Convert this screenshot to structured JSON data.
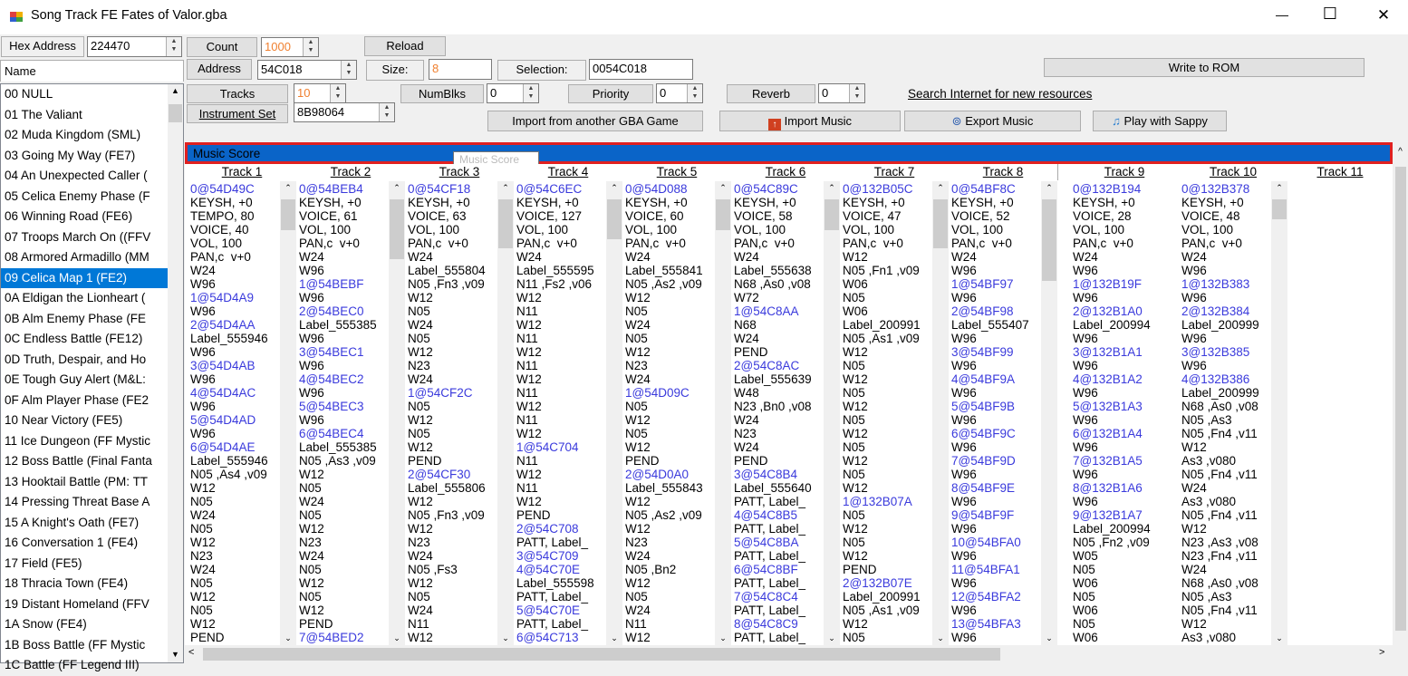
{
  "window": {
    "title": "Song Track FE Fates of Valor.gba",
    "minimize": "—",
    "maximize": "☐",
    "close": "✕"
  },
  "sidebar": {
    "hex_label": "Hex Address",
    "hex_value": "224470",
    "name_header": "Name",
    "songs": [
      "00 NULL",
      "01 The Valiant",
      "02 Muda Kingdom (SML)",
      "03 Going My Way (FE7)",
      "04 An Unexpected Caller (",
      "05 Celica Enemy Phase (F",
      "06 Winning Road (FE6)",
      "07 Troops March On ((FFV",
      "08 Armored Armadillo (MM",
      "09 Celica Map 1 (FE2)",
      "0A Eldigan the Lionheart (",
      "0B Alm Enemy Phase (FE",
      "0C Endless Battle (FE12)",
      "0D Truth, Despair, and Ho",
      "0E Tough Guy Alert (M&L:",
      "0F Alm Player Phase (FE2",
      "10 Near Victory (FE5)",
      "11 Ice Dungeon (FF Mystic",
      "12 Boss Battle (Final Fanta",
      "13 Hooktail Battle (PM: TT",
      "14 Pressing Threat Base A",
      "15 A Knight's Oath (FE7)",
      "16 Conversation 1 (FE4)",
      "17 Field (FE5)",
      "18 Thracia Town (FE4)",
      "19 Distant Homeland (FFV",
      "1A Snow (FE4)",
      "1B Boss Battle (FF Mystic",
      "1C Battle (FF Legend III)"
    ],
    "selected_index": 9
  },
  "toolbar": {
    "count_label": "Count",
    "count_value": "1000",
    "reload_label": "Reload",
    "address_label": "Address",
    "address_value": "54C018",
    "size_label": "Size:",
    "size_value": "8",
    "selection_label": "Selection:",
    "selection_value": "0054C018",
    "write_rom": "Write to ROM",
    "tracks_label": "Tracks",
    "tracks_value": "10",
    "numblks_label": "NumBlks",
    "numblks_value": "0",
    "priority_label": "Priority",
    "priority_value": "0",
    "reverb_label": "Reverb",
    "reverb_value": "0",
    "search_link": "Search Internet for new resources",
    "instrument_label": "Instrument Set",
    "instrument_value": "8B98064",
    "import_gba": "Import from another GBA Game",
    "import_music": "Import Music",
    "export_music": "Export Music",
    "play_sappy": "Play with Sappy"
  },
  "score": {
    "bar_label": "Music Score",
    "tooltip": "Music Score"
  },
  "tracks": [
    {
      "title": "Track 1",
      "lines": [
        "0@54D49C",
        "KEYSH, +0",
        "TEMPO, 80",
        "VOICE, 40",
        "VOL, 100",
        "PAN,c  v+0",
        "W24",
        "W96",
        "1@54D4A9",
        "W96",
        "2@54D4AA",
        "Label_555946",
        "W96",
        "3@54D4AB",
        "W96",
        "4@54D4AC",
        "W96",
        "5@54D4AD",
        "W96",
        "6@54D4AE",
        "Label_555946",
        "N05 ,As4 ,v09",
        "W12",
        "N05",
        "W24",
        "N05",
        "W12",
        "N23",
        "W24",
        "N05",
        "W12",
        "N05",
        "W12",
        "PEND"
      ]
    },
    {
      "title": "Track 2",
      "lines": [
        "0@54BEB4",
        "KEYSH, +0",
        "VOICE, 61",
        "VOL, 100",
        "PAN,c  v+0",
        "W24",
        "W96",
        "1@54BEBF",
        "W96",
        "2@54BEC0",
        "Label_555385",
        "W96",
        "3@54BEC1",
        "W96",
        "4@54BEC2",
        "W96",
        "5@54BEC3",
        "W96",
        "6@54BEC4",
        "Label_555385",
        "N05 ,As3 ,v09",
        "W12",
        "N05",
        "W24",
        "N05",
        "W12",
        "N23",
        "W24",
        "N05",
        "W12",
        "N05",
        "W12",
        "PEND",
        "7@54BED2"
      ]
    },
    {
      "title": "Track 3",
      "lines": [
        "0@54CF18",
        "KEYSH, +0",
        "VOICE, 63",
        "VOL, 100",
        "PAN,c  v+0",
        "W24",
        "Label_555804",
        "N05 ,Fn3 ,v09",
        "W12",
        "N05",
        "W24",
        "N05",
        "W12",
        "N23",
        "W24",
        "1@54CF2C",
        "N05",
        "W12",
        "N05",
        "W12",
        "PEND",
        "2@54CF30",
        "Label_555806",
        "W12",
        "N05 ,Fn3 ,v09",
        "W12",
        "N23",
        "W24",
        "N05 ,Fs3",
        "W12",
        "N05",
        "W24",
        "N11",
        "W12"
      ]
    },
    {
      "title": "Track 4",
      "lines": [
        "0@54C6EC",
        "KEYSH, +0",
        "VOICE, 127",
        "VOL, 100",
        "PAN,c  v+0",
        "W24",
        "Label_555595",
        "N11 ,Fs2 ,v06",
        "W12",
        "N11",
        "W12",
        "N11",
        "W12",
        "N11",
        "W12",
        "N11",
        "W12",
        "N11",
        "W12",
        "1@54C704",
        "N11",
        "W12",
        "N11",
        "W12",
        "PEND",
        "2@54C708",
        "PATT, Label_",
        "3@54C709",
        "4@54C70E",
        "Label_555598",
        "PATT, Label_",
        "5@54C70E",
        "PATT, Label_",
        "6@54C713"
      ]
    },
    {
      "title": "Track 5",
      "lines": [
        "0@54D088",
        "KEYSH, +0",
        "VOICE, 60",
        "VOL, 100",
        "PAN,c  v+0",
        "W24",
        "Label_555841",
        "N05 ,As2 ,v09",
        "W12",
        "N05",
        "W24",
        "N05",
        "W12",
        "N23",
        "W24",
        "1@54D09C",
        "N05",
        "W12",
        "N05",
        "W12",
        "PEND",
        "2@54D0A0",
        "Label_555843",
        "W12",
        "N05 ,As2 ,v09",
        "W12",
        "N23",
        "W24",
        "N05 ,Bn2",
        "W12",
        "N05",
        "W24",
        "N11",
        "W12"
      ]
    },
    {
      "title": "Track 6",
      "lines": [
        "0@54C89C",
        "KEYSH, +0",
        "VOICE, 58",
        "VOL, 100",
        "PAN,c  v+0",
        "W24",
        "Label_555638",
        "N68 ,As0 ,v08",
        "W72",
        "1@54C8AA",
        "N68",
        "W24",
        "PEND",
        "2@54C8AC",
        "Label_555639",
        "W48",
        "N23 ,Bn0 ,v08",
        "W24",
        "N23",
        "W24",
        "PEND",
        "3@54C8B4",
        "Label_555640",
        "PATT, Label_",
        "4@54C8B5",
        "PATT, Label_",
        "5@54C8BA",
        "PATT, Label_",
        "6@54C8BF",
        "PATT, Label_",
        "7@54C8C4",
        "PATT, Label_",
        "8@54C8C9",
        "PATT, Label_"
      ]
    },
    {
      "title": "Track 7",
      "lines": [
        "0@132B05C",
        "KEYSH, +0",
        "VOICE, 47",
        "VOL, 100",
        "PAN,c  v+0",
        "W12",
        "N05 ,Fn1 ,v09",
        "W06",
        "N05",
        "W06",
        "Label_200991",
        "N05 ,As1 ,v09",
        "W12",
        "N05",
        "W12",
        "N05",
        "W12",
        "N05",
        "W12",
        "N05",
        "W12",
        "N05",
        "W12",
        "1@132B07A",
        "N05",
        "W12",
        "N05",
        "W12",
        "PEND",
        "2@132B07E",
        "Label_200991",
        "N05 ,As1 ,v09",
        "W12",
        "N05"
      ]
    },
    {
      "title": "Track 8",
      "lines": [
        "0@54BF8C",
        "KEYSH, +0",
        "VOICE, 52",
        "VOL, 100",
        "PAN,c  v+0",
        "W24",
        "W96",
        "1@54BF97",
        "W96",
        "2@54BF98",
        "Label_555407",
        "W96",
        "3@54BF99",
        "W96",
        "4@54BF9A",
        "W96",
        "5@54BF9B",
        "W96",
        "6@54BF9C",
        "W96",
        "7@54BF9D",
        "W96",
        "8@54BF9E",
        "W96",
        "9@54BF9F",
        "W96",
        "10@54BFA0",
        "W96",
        "11@54BFA1",
        "W96",
        "12@54BFA2",
        "W96",
        "13@54BFA3",
        "W96"
      ]
    },
    {
      "title": "Track 9",
      "lines": [
        "0@132B194",
        "KEYSH, +0",
        "VOICE, 28",
        "VOL, 100",
        "PAN,c  v+0",
        "W24",
        "W96",
        "1@132B19F",
        "W96",
        "2@132B1A0",
        "Label_200994",
        "W96",
        "3@132B1A1",
        "W96",
        "4@132B1A2",
        "W96",
        "5@132B1A3",
        "W96",
        "6@132B1A4",
        "W96",
        "7@132B1A5",
        "W96",
        "8@132B1A6",
        "W96",
        "9@132B1A7",
        "Label_200994",
        "N05 ,Fn2 ,v09",
        "W05",
        "N05",
        "W06",
        "N05",
        "W06",
        "N05",
        "W06"
      ]
    },
    {
      "title": "Track 10",
      "lines": [
        "0@132B378",
        "KEYSH, +0",
        "VOICE, 48",
        "VOL, 100",
        "PAN,c  v+0",
        "W24",
        "W96",
        "1@132B383",
        "W96",
        "2@132B384",
        "Label_200999",
        "W96",
        "3@132B385",
        "W96",
        "4@132B386",
        "Label_200999",
        "N68 ,As0 ,v08",
        "N05 ,As3",
        "N05 ,Fn4 ,v11",
        "W12",
        "As3 ,v080",
        "N05 ,Fn4 ,v11",
        "W24",
        "As3 ,v080",
        "N05 ,Fn4 ,v11",
        "W12",
        "N23 ,As3 ,v08",
        "N23 ,Fn4 ,v11",
        "W24",
        "N68 ,As0 ,v08",
        "N05 ,As3",
        "N05 ,Fn4 ,v11",
        "W12",
        "As3 ,v080"
      ]
    },
    {
      "title": "Track 11",
      "lines": []
    }
  ],
  "colors": {
    "selection_blue": "#0078d7",
    "score_bar_blue": "#0a64c8",
    "score_border_red": "#e02020",
    "pointer_blue": "#3a3adc",
    "orange_value": "#f08030"
  }
}
